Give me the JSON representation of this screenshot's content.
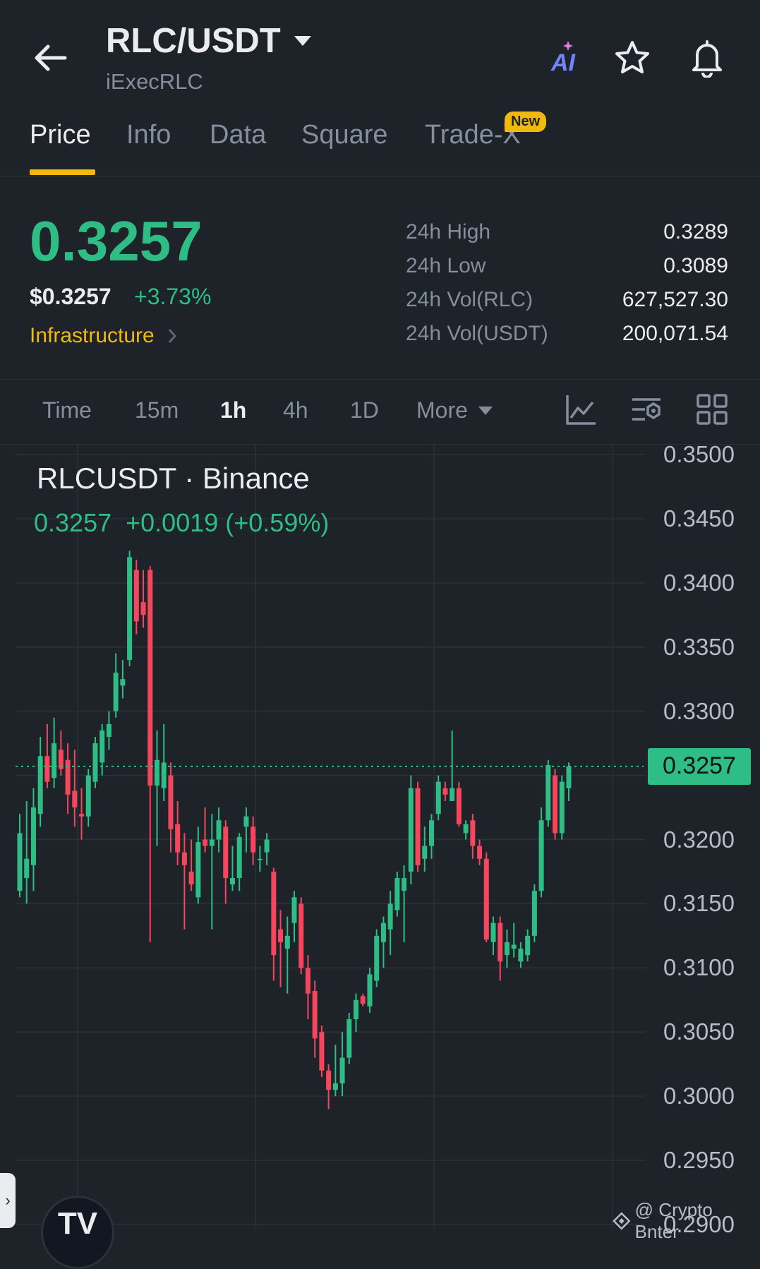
{
  "header": {
    "pair": "RLC/USDT",
    "subtitle": "iExecRLC",
    "icons": [
      "back-arrow-icon",
      "chevron-down-icon",
      "ai-icon",
      "star-icon",
      "bell-icon"
    ],
    "ai_label": "AI"
  },
  "tabs": [
    {
      "label": "Price",
      "active": true
    },
    {
      "label": "Info"
    },
    {
      "label": "Data"
    },
    {
      "label": "Square"
    },
    {
      "label": "Trade-X",
      "badge": "New"
    }
  ],
  "price": {
    "last": "0.3257",
    "usd": "$0.3257",
    "change_pct": "+3.73%",
    "category": "Infrastructure"
  },
  "stats": [
    {
      "label": "24h High",
      "value": "0.3289"
    },
    {
      "label": "24h Low",
      "value": "0.3089"
    },
    {
      "label": "24h Vol(RLC)",
      "value": "627,527.30"
    },
    {
      "label": "24h Vol(USDT)",
      "value": "200,071.54"
    }
  ],
  "intervals": [
    {
      "label": "Time"
    },
    {
      "label": "15m"
    },
    {
      "label": "1h",
      "active": true
    },
    {
      "label": "4h"
    },
    {
      "label": "1D"
    },
    {
      "label": "More"
    }
  ],
  "tools": [
    "line-chart-icon",
    "indicator-settings-icon",
    "grid-layout-icon"
  ],
  "chart": {
    "title": "RLCUSDT · Binance",
    "legend_price": "0.3257",
    "legend_change": "+0.0019 (+0.59%)",
    "current_price_label": "0.3257",
    "watermark": "@ Crypto Bnter",
    "tv_logo": "TV"
  },
  "colors": {
    "background": "#1e2329",
    "up": "#2ebd85",
    "down": "#f6465d",
    "accent": "#f0b90b"
  },
  "chart_data": {
    "type": "candlestick",
    "title": "RLCUSDT · Binance",
    "interval": "1h",
    "ylim": [
      0.29,
      0.35
    ],
    "y_ticks": [
      "0.3500",
      "0.3450",
      "0.3400",
      "0.3350",
      "0.3300",
      "0.3250",
      "0.3200",
      "0.3150",
      "0.3100",
      "0.3050",
      "0.3000",
      "0.2950",
      "0.2900"
    ],
    "last_price": 0.3257,
    "candles": [
      {
        "o": 0.316,
        "h": 0.322,
        "l": 0.3155,
        "c": 0.3205
      },
      {
        "o": 0.317,
        "h": 0.323,
        "l": 0.315,
        "c": 0.3185
      },
      {
        "o": 0.318,
        "h": 0.324,
        "l": 0.316,
        "c": 0.3225
      },
      {
        "o": 0.322,
        "h": 0.328,
        "l": 0.321,
        "c": 0.3265
      },
      {
        "o": 0.3265,
        "h": 0.329,
        "l": 0.324,
        "c": 0.3245
      },
      {
        "o": 0.3248,
        "h": 0.3295,
        "l": 0.324,
        "c": 0.3275
      },
      {
        "o": 0.327,
        "h": 0.3285,
        "l": 0.325,
        "c": 0.3255
      },
      {
        "o": 0.3262,
        "h": 0.3275,
        "l": 0.322,
        "c": 0.3235
      },
      {
        "o": 0.3238,
        "h": 0.327,
        "l": 0.321,
        "c": 0.3225
      },
      {
        "o": 0.322,
        "h": 0.324,
        "l": 0.32,
        "c": 0.3218
      },
      {
        "o": 0.3218,
        "h": 0.3255,
        "l": 0.321,
        "c": 0.325
      },
      {
        "o": 0.3245,
        "h": 0.328,
        "l": 0.324,
        "c": 0.3275
      },
      {
        "o": 0.326,
        "h": 0.329,
        "l": 0.325,
        "c": 0.3285
      },
      {
        "o": 0.328,
        "h": 0.33,
        "l": 0.327,
        "c": 0.329
      },
      {
        "o": 0.33,
        "h": 0.3345,
        "l": 0.3295,
        "c": 0.333
      },
      {
        "o": 0.332,
        "h": 0.334,
        "l": 0.331,
        "c": 0.3325
      },
      {
        "o": 0.334,
        "h": 0.3425,
        "l": 0.3335,
        "c": 0.342
      },
      {
        "o": 0.341,
        "h": 0.3418,
        "l": 0.336,
        "c": 0.337
      },
      {
        "o": 0.3385,
        "h": 0.341,
        "l": 0.3365,
        "c": 0.3375
      },
      {
        "o": 0.341,
        "h": 0.3413,
        "l": 0.312,
        "c": 0.3242
      },
      {
        "o": 0.3242,
        "h": 0.3285,
        "l": 0.3195,
        "c": 0.3262
      },
      {
        "o": 0.324,
        "h": 0.329,
        "l": 0.323,
        "c": 0.326
      },
      {
        "o": 0.325,
        "h": 0.326,
        "l": 0.319,
        "c": 0.3208
      },
      {
        "o": 0.3212,
        "h": 0.323,
        "l": 0.318,
        "c": 0.319
      },
      {
        "o": 0.319,
        "h": 0.3205,
        "l": 0.313,
        "c": 0.318
      },
      {
        "o": 0.3175,
        "h": 0.32,
        "l": 0.316,
        "c": 0.3165
      },
      {
        "o": 0.3155,
        "h": 0.321,
        "l": 0.315,
        "c": 0.3198
      },
      {
        "o": 0.32,
        "h": 0.3225,
        "l": 0.319,
        "c": 0.3195
      },
      {
        "o": 0.3195,
        "h": 0.322,
        "l": 0.313,
        "c": 0.32
      },
      {
        "o": 0.32,
        "h": 0.3225,
        "l": 0.319,
        "c": 0.3215
      },
      {
        "o": 0.321,
        "h": 0.3215,
        "l": 0.315,
        "c": 0.317
      },
      {
        "o": 0.3165,
        "h": 0.3195,
        "l": 0.316,
        "c": 0.317
      },
      {
        "o": 0.317,
        "h": 0.3205,
        "l": 0.316,
        "c": 0.3202
      },
      {
        "o": 0.321,
        "h": 0.3225,
        "l": 0.319,
        "c": 0.3218
      },
      {
        "o": 0.321,
        "h": 0.3218,
        "l": 0.318,
        "c": 0.319
      },
      {
        "o": 0.3185,
        "h": 0.3195,
        "l": 0.3175,
        "c": 0.3185
      },
      {
        "o": 0.319,
        "h": 0.3205,
        "l": 0.318,
        "c": 0.32
      },
      {
        "o": 0.3175,
        "h": 0.3178,
        "l": 0.309,
        "c": 0.311
      },
      {
        "o": 0.313,
        "h": 0.3145,
        "l": 0.3085,
        "c": 0.312
      },
      {
        "o": 0.3115,
        "h": 0.314,
        "l": 0.308,
        "c": 0.3125
      },
      {
        "o": 0.3135,
        "h": 0.316,
        "l": 0.312,
        "c": 0.3155
      },
      {
        "o": 0.315,
        "h": 0.3155,
        "l": 0.3095,
        "c": 0.31
      },
      {
        "o": 0.31,
        "h": 0.311,
        "l": 0.306,
        "c": 0.308
      },
      {
        "o": 0.3082,
        "h": 0.309,
        "l": 0.303,
        "c": 0.3045
      },
      {
        "o": 0.305,
        "h": 0.3055,
        "l": 0.3015,
        "c": 0.302
      },
      {
        "o": 0.302,
        "h": 0.3025,
        "l": 0.299,
        "c": 0.3005
      },
      {
        "o": 0.3005,
        "h": 0.304,
        "l": 0.3,
        "c": 0.301
      },
      {
        "o": 0.301,
        "h": 0.305,
        "l": 0.3,
        "c": 0.303
      },
      {
        "o": 0.303,
        "h": 0.3065,
        "l": 0.3025,
        "c": 0.306
      },
      {
        "o": 0.306,
        "h": 0.308,
        "l": 0.305,
        "c": 0.3075
      },
      {
        "o": 0.3078,
        "h": 0.308,
        "l": 0.307,
        "c": 0.3072
      },
      {
        "o": 0.307,
        "h": 0.31,
        "l": 0.3065,
        "c": 0.3095
      },
      {
        "o": 0.309,
        "h": 0.313,
        "l": 0.3085,
        "c": 0.3125
      },
      {
        "o": 0.312,
        "h": 0.314,
        "l": 0.31,
        "c": 0.3135
      },
      {
        "o": 0.313,
        "h": 0.316,
        "l": 0.311,
        "c": 0.315
      },
      {
        "o": 0.3145,
        "h": 0.3175,
        "l": 0.314,
        "c": 0.317
      },
      {
        "o": 0.316,
        "h": 0.318,
        "l": 0.312,
        "c": 0.317
      },
      {
        "o": 0.3175,
        "h": 0.325,
        "l": 0.3165,
        "c": 0.324
      },
      {
        "o": 0.324,
        "h": 0.3245,
        "l": 0.3175,
        "c": 0.318
      },
      {
        "o": 0.3185,
        "h": 0.321,
        "l": 0.3175,
        "c": 0.3195
      },
      {
        "o": 0.3195,
        "h": 0.322,
        "l": 0.3185,
        "c": 0.3215
      },
      {
        "o": 0.322,
        "h": 0.325,
        "l": 0.3215,
        "c": 0.3245
      },
      {
        "o": 0.324,
        "h": 0.3245,
        "l": 0.323,
        "c": 0.3235
      },
      {
        "o": 0.323,
        "h": 0.3285,
        "l": 0.3235,
        "c": 0.324
      },
      {
        "o": 0.324,
        "h": 0.3245,
        "l": 0.321,
        "c": 0.3212
      },
      {
        "o": 0.3205,
        "h": 0.3215,
        "l": 0.32,
        "c": 0.3212
      },
      {
        "o": 0.3215,
        "h": 0.322,
        "l": 0.3185,
        "c": 0.3195
      },
      {
        "o": 0.3195,
        "h": 0.32,
        "l": 0.318,
        "c": 0.3185
      },
      {
        "o": 0.3185,
        "h": 0.319,
        "l": 0.312,
        "c": 0.3122
      },
      {
        "o": 0.312,
        "h": 0.314,
        "l": 0.311,
        "c": 0.3135
      },
      {
        "o": 0.3135,
        "h": 0.314,
        "l": 0.309,
        "c": 0.3105
      },
      {
        "o": 0.311,
        "h": 0.313,
        "l": 0.31,
        "c": 0.312
      },
      {
        "o": 0.3115,
        "h": 0.3135,
        "l": 0.3108,
        "c": 0.3118
      },
      {
        "o": 0.3105,
        "h": 0.312,
        "l": 0.31,
        "c": 0.3115
      },
      {
        "o": 0.311,
        "h": 0.313,
        "l": 0.3105,
        "c": 0.3125
      },
      {
        "o": 0.3125,
        "h": 0.3165,
        "l": 0.312,
        "c": 0.316
      },
      {
        "o": 0.316,
        "h": 0.3225,
        "l": 0.3155,
        "c": 0.3215
      },
      {
        "o": 0.3215,
        "h": 0.3262,
        "l": 0.321,
        "c": 0.3258
      },
      {
        "o": 0.325,
        "h": 0.3255,
        "l": 0.32,
        "c": 0.3205
      },
      {
        "o": 0.3205,
        "h": 0.325,
        "l": 0.32,
        "c": 0.3245
      },
      {
        "o": 0.324,
        "h": 0.326,
        "l": 0.323,
        "c": 0.3257
      }
    ]
  }
}
